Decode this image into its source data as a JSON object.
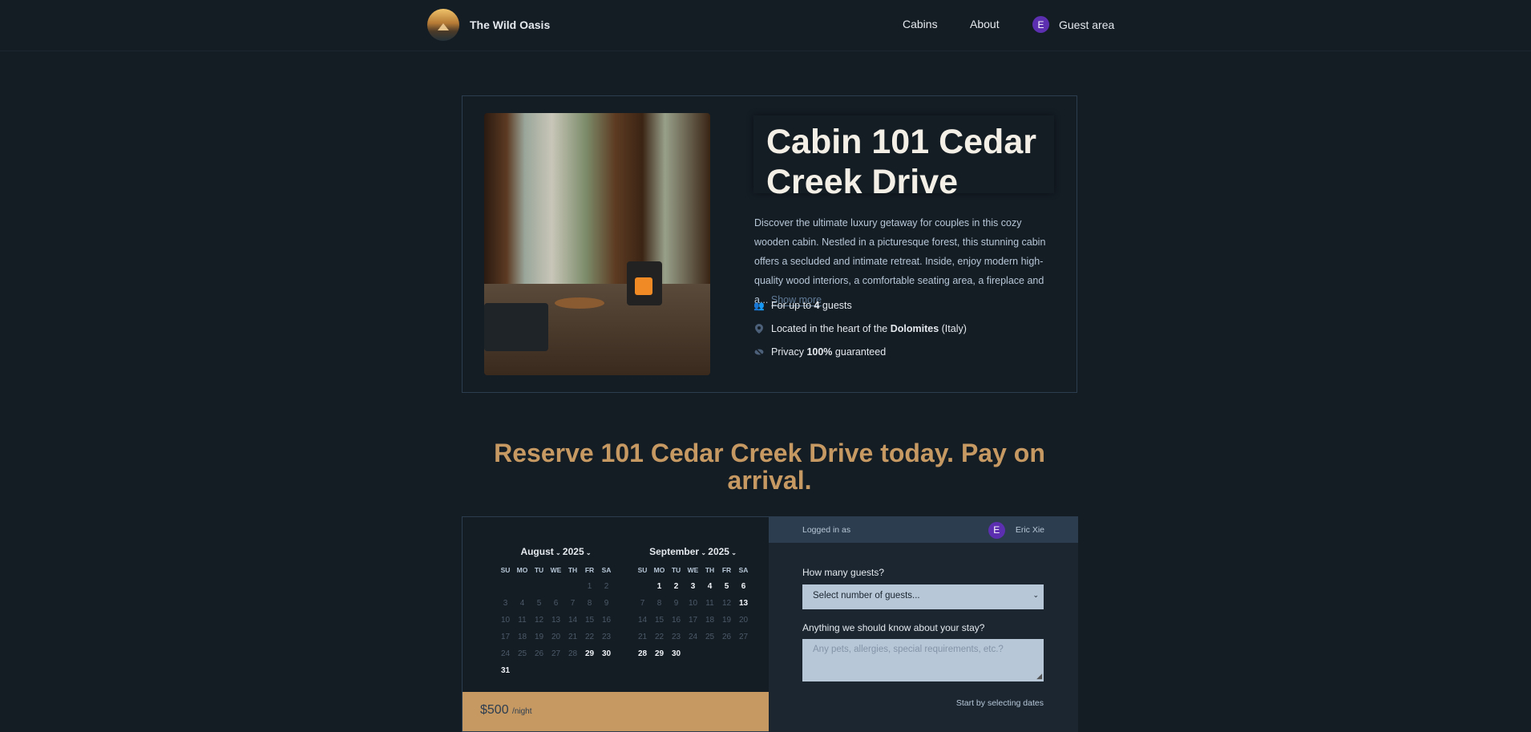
{
  "header": {
    "brand": "The Wild Oasis",
    "nav": {
      "cabins": "Cabins",
      "about": "About",
      "guest_area": "Guest area",
      "avatar_initial": "E"
    }
  },
  "cabin": {
    "title": "Cabin 101 Cedar Creek Drive",
    "description": "Discover the ultimate luxury getaway for couples in this cozy wooden cabin. Nestled in a picturesque forest, this stunning cabin offers a secluded and intimate retreat. Inside, enjoy modern high-quality wood interiors, a comfortable seating area, a fireplace and a...",
    "show_more": "Show more",
    "features": {
      "guests_pre": "For up to ",
      "guests_num": "4",
      "guests_post": " guests",
      "loc_pre": "Located in the heart of the ",
      "loc_bold": "Dolomites",
      "loc_post": " (Italy)",
      "priv_pre": "Privacy ",
      "priv_bold": "100%",
      "priv_post": " guaranteed"
    }
  },
  "reserve_heading": "Reserve 101 Cedar Creek Drive today. Pay on arrival.",
  "calendar": {
    "weekdays": [
      "SU",
      "MO",
      "TU",
      "WE",
      "TH",
      "FR",
      "SA"
    ],
    "months": [
      {
        "month": "August",
        "year": "2025",
        "offset": 5,
        "days": 31,
        "available": [
          29,
          30,
          31
        ]
      },
      {
        "month": "September",
        "year": "2025",
        "offset": 1,
        "days": 30,
        "available": [
          1,
          2,
          3,
          4,
          5,
          6,
          13,
          28,
          29,
          30
        ]
      }
    ]
  },
  "price": {
    "amount": "$500",
    "unit": "/night"
  },
  "form": {
    "logged_in_as": "Logged in as",
    "user_name": "Eric Xie",
    "user_initial": "E",
    "guests_label": "How many guests?",
    "guests_placeholder": "Select number of guests...",
    "notes_label": "Anything we should know about your stay?",
    "notes_placeholder": "Any pets, allergies, special requirements, etc.?",
    "hint": "Start by selecting dates"
  }
}
